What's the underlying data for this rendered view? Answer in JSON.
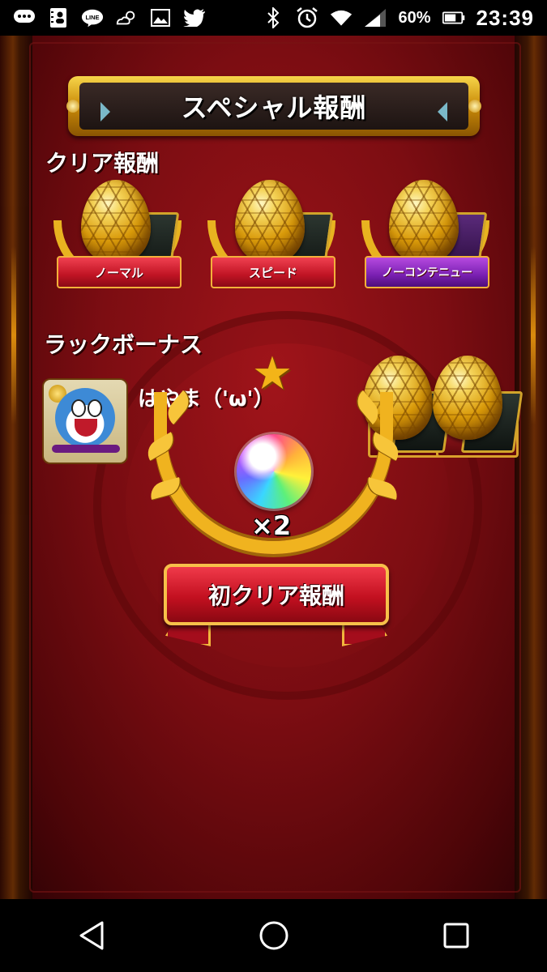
{
  "status_bar": {
    "battery_percent": "60%",
    "time": "23:39",
    "icons": [
      "chat-bubble-icon",
      "contact-card-icon",
      "line-app-icon",
      "weather-icon",
      "gallery-icon",
      "twitter-icon",
      "bluetooth-icon",
      "alarm-icon",
      "wifi-icon",
      "signal-icon",
      "battery-icon"
    ]
  },
  "header": {
    "title": "スペシャル報酬"
  },
  "clear_rewards": {
    "title": "クリア報酬",
    "items": [
      {
        "label": "ノーマル",
        "ribbon_color": "#c01424",
        "icon": "gold-egg-icon"
      },
      {
        "label": "スピード",
        "ribbon_color": "#c01424",
        "icon": "gold-egg-icon"
      },
      {
        "label": "ノーコンテニュー",
        "ribbon_color": "#7a20b2",
        "icon": "gold-egg-icon"
      }
    ]
  },
  "luck_bonus": {
    "title": "ラックボーナス",
    "player_name": "はやま（'ω'）",
    "rewards": [
      {
        "icon": "gold-egg-icon"
      },
      {
        "icon": "gold-egg-icon"
      }
    ]
  },
  "first_clear_popup": {
    "item_icon": "rainbow-orb-icon",
    "count": "×2",
    "label": "初クリア報酬"
  },
  "nav_bar": {
    "buttons": [
      "back-icon",
      "home-icon",
      "recents-icon"
    ]
  },
  "colors": {
    "background_red": "#7c0d12",
    "gold": "#f0b31f",
    "ribbon_red": "#c31020",
    "ribbon_purple": "#7a20b2"
  }
}
